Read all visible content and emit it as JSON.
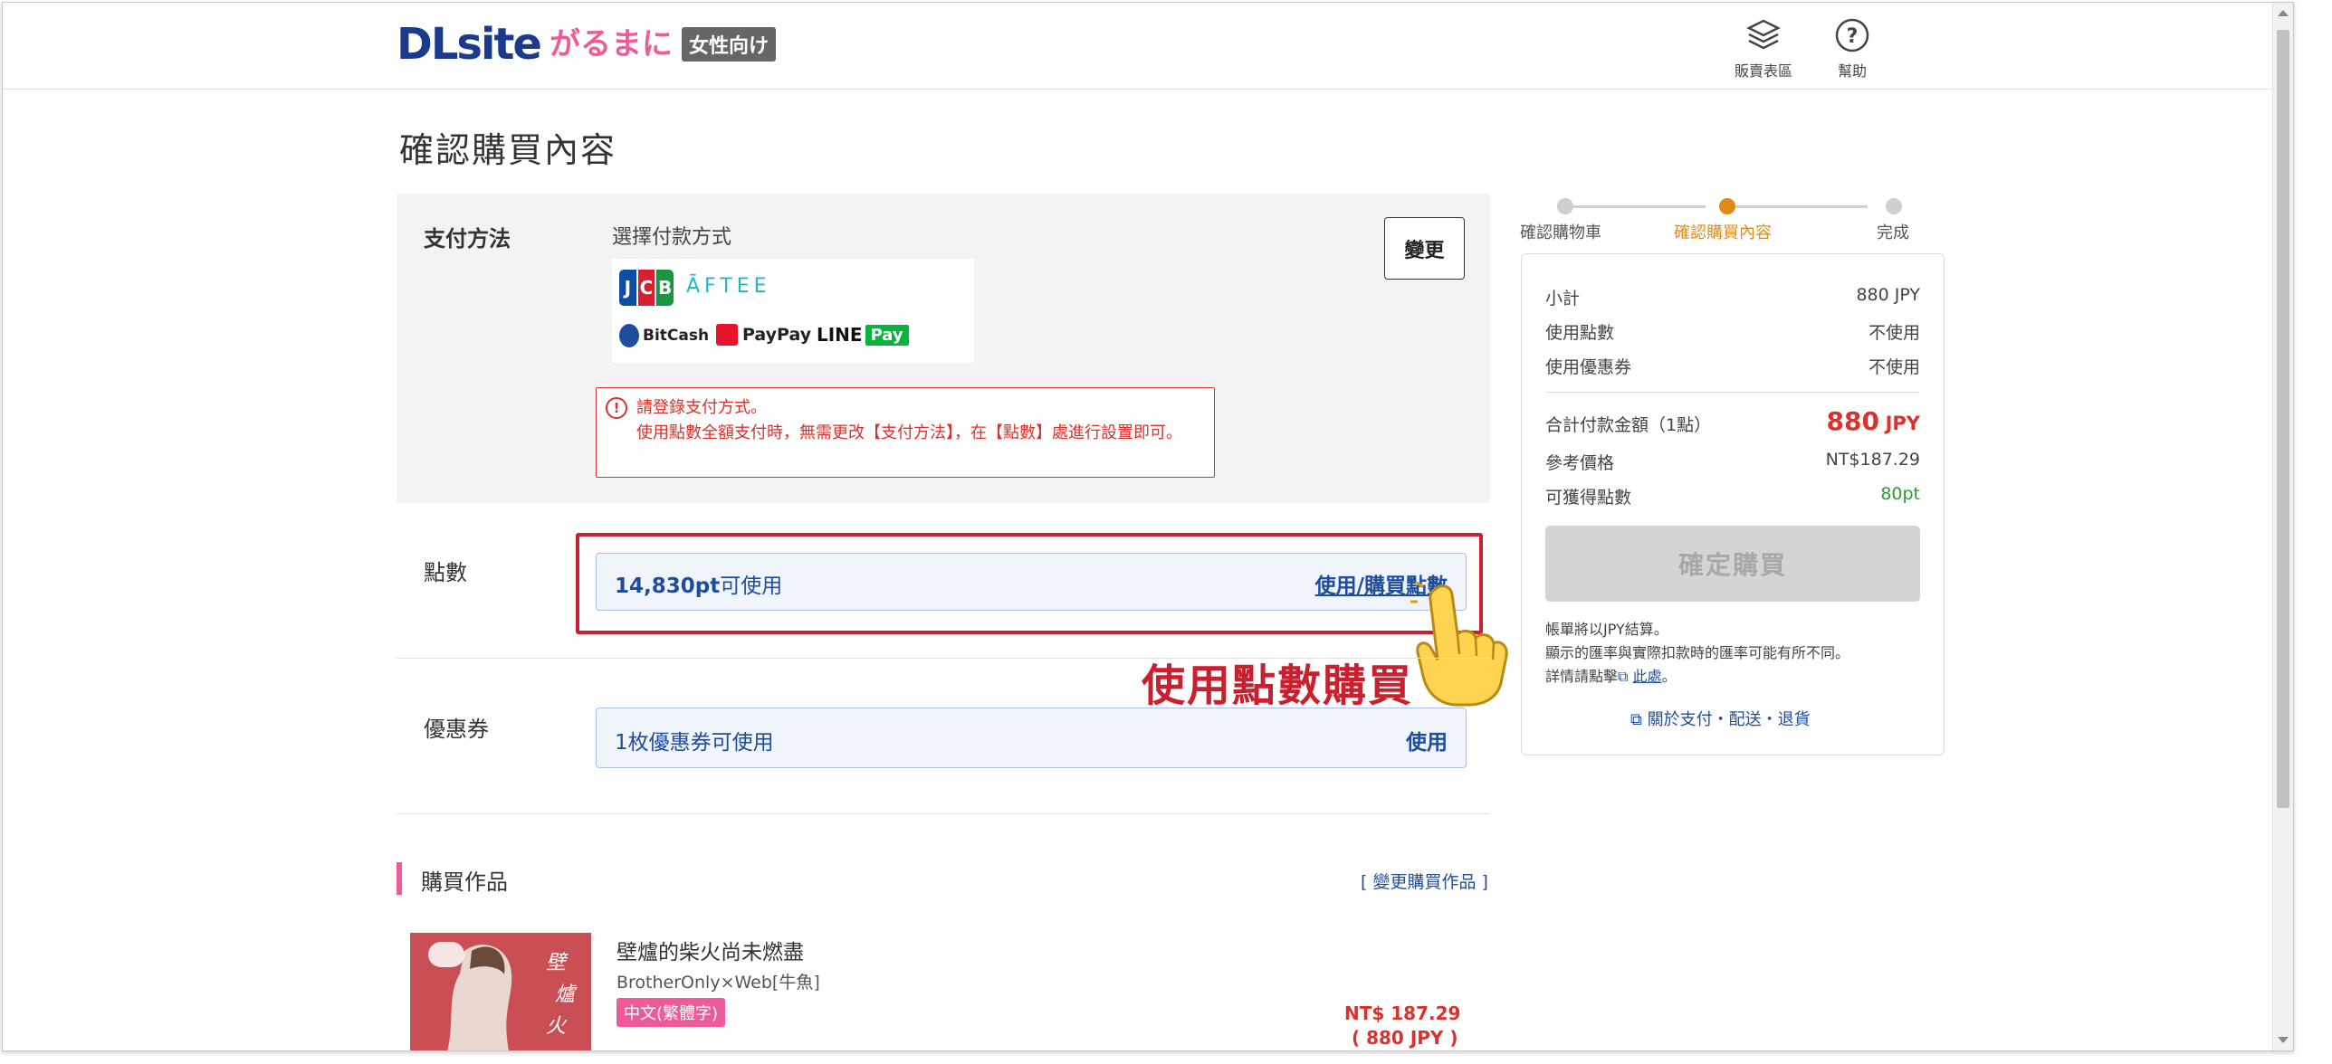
{
  "header": {
    "logo_main": "DLsite",
    "logo_sub": "がるまに",
    "logo_badge": "女性向け",
    "nav": [
      {
        "label": "販賣表區",
        "icon": "layers-icon"
      },
      {
        "label": "幫助",
        "icon": "help-icon"
      }
    ]
  },
  "page": {
    "title": "確認購買內容"
  },
  "payment": {
    "label": "支付方法",
    "select_text": "選擇付款方式",
    "change_button": "變更",
    "methods": [
      "JCB",
      "ĀFTEE",
      "BitCash",
      "PayPay",
      "LINE Pay"
    ],
    "warning_line1": "請登錄支付方式。",
    "warning_line2": "使用點數全額支付時，無需更改【支付方法】，在【點數】處進行設置即可。"
  },
  "points": {
    "label": "點數",
    "amount": "14,830pt",
    "available_suffix": "可使用",
    "link": "使用/購買點數",
    "callout": "使用點數購買"
  },
  "coupon": {
    "label": "優惠券",
    "text": "1枚優惠券可使用",
    "link": "使用"
  },
  "works": {
    "title": "購買作品",
    "change_link": "[ 變更購買作品 ]",
    "items": [
      {
        "title": "壁爐的柴火尚未燃盡",
        "author": "BrotherOnly×Web[牛魚]",
        "tag": "中文(繁體字)",
        "price_twd": "NT$ 187.29",
        "price_jpy": "( 880 JPY )"
      }
    ]
  },
  "steps": [
    {
      "label": "確認購物車",
      "state": "done"
    },
    {
      "label": "確認購買內容",
      "state": "current"
    },
    {
      "label": "完成",
      "state": "todo"
    }
  ],
  "summary": {
    "subtotal_label": "小計",
    "subtotal_value": "880 JPY",
    "points_label": "使用點數",
    "points_value": "不使用",
    "coupon_label": "使用優惠券",
    "coupon_value": "不使用",
    "total_label": "合計付款金額（1點）",
    "total_value": "880",
    "total_currency": "JPY",
    "ref_label": "參考價格",
    "ref_value": "NT$187.29",
    "earn_label": "可獲得點數",
    "earn_value": "80pt",
    "buy_button": "確定購買",
    "note_line1": "帳單將以JPY結算。",
    "note_line2": "顯示的匯率與實際扣款時的匯率可能有所不同。",
    "note_line3_prefix": "詳情請點擊",
    "note_line3_link": "此處",
    "note_line3_suffix": "。",
    "about_link": "關於支付・配送・退貨"
  },
  "colors": {
    "brand_blue": "#1b3a8a",
    "accent_pink": "#ee5b98",
    "link_blue": "#1e4d9b",
    "warning_red": "#d9322c",
    "step_active": "#e08a14",
    "earn_green": "#2e9a37"
  }
}
